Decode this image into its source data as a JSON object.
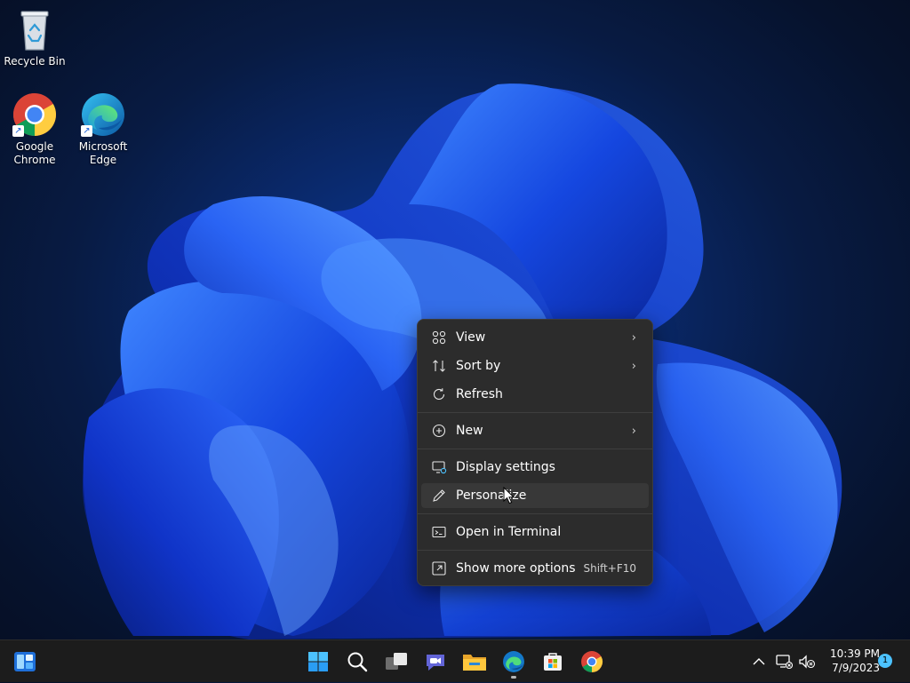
{
  "desktop": {
    "icons": [
      {
        "label": "Recycle Bin",
        "icon": "recycle-bin-icon"
      },
      {
        "label": "Google Chrome",
        "icon": "chrome-icon"
      },
      {
        "label": "Microsoft Edge",
        "icon": "edge-icon"
      }
    ]
  },
  "context_menu": {
    "items": [
      {
        "label": "View",
        "icon": "view-grid-icon",
        "submenu": true
      },
      {
        "label": "Sort by",
        "icon": "sort-icon",
        "submenu": true
      },
      {
        "label": "Refresh",
        "icon": "refresh-icon"
      },
      {
        "label": "New",
        "icon": "new-plus-icon",
        "submenu": true
      },
      {
        "label": "Display settings",
        "icon": "display-settings-icon"
      },
      {
        "label": "Personalize",
        "icon": "pen-icon",
        "hovered": true
      },
      {
        "label": "Open in Terminal",
        "icon": "terminal-icon"
      },
      {
        "label": "Show more options",
        "icon": "show-more-icon",
        "shortcut": "Shift+F10"
      }
    ]
  },
  "taskbar": {
    "pinned": [
      "widgets-icon",
      "start-icon",
      "search-icon",
      "task-view-icon",
      "teams-chat-icon",
      "file-explorer-icon",
      "edge-icon",
      "store-icon",
      "chrome-icon"
    ],
    "tray": {
      "time": "10:39 PM",
      "date": "7/9/2023",
      "notification_count": "1"
    }
  },
  "colors": {
    "menu_bg": "#2c2c2c",
    "menu_hover": "#383838",
    "taskbar_bg": "#1c1c1c",
    "accent": "#4cc2ff"
  }
}
